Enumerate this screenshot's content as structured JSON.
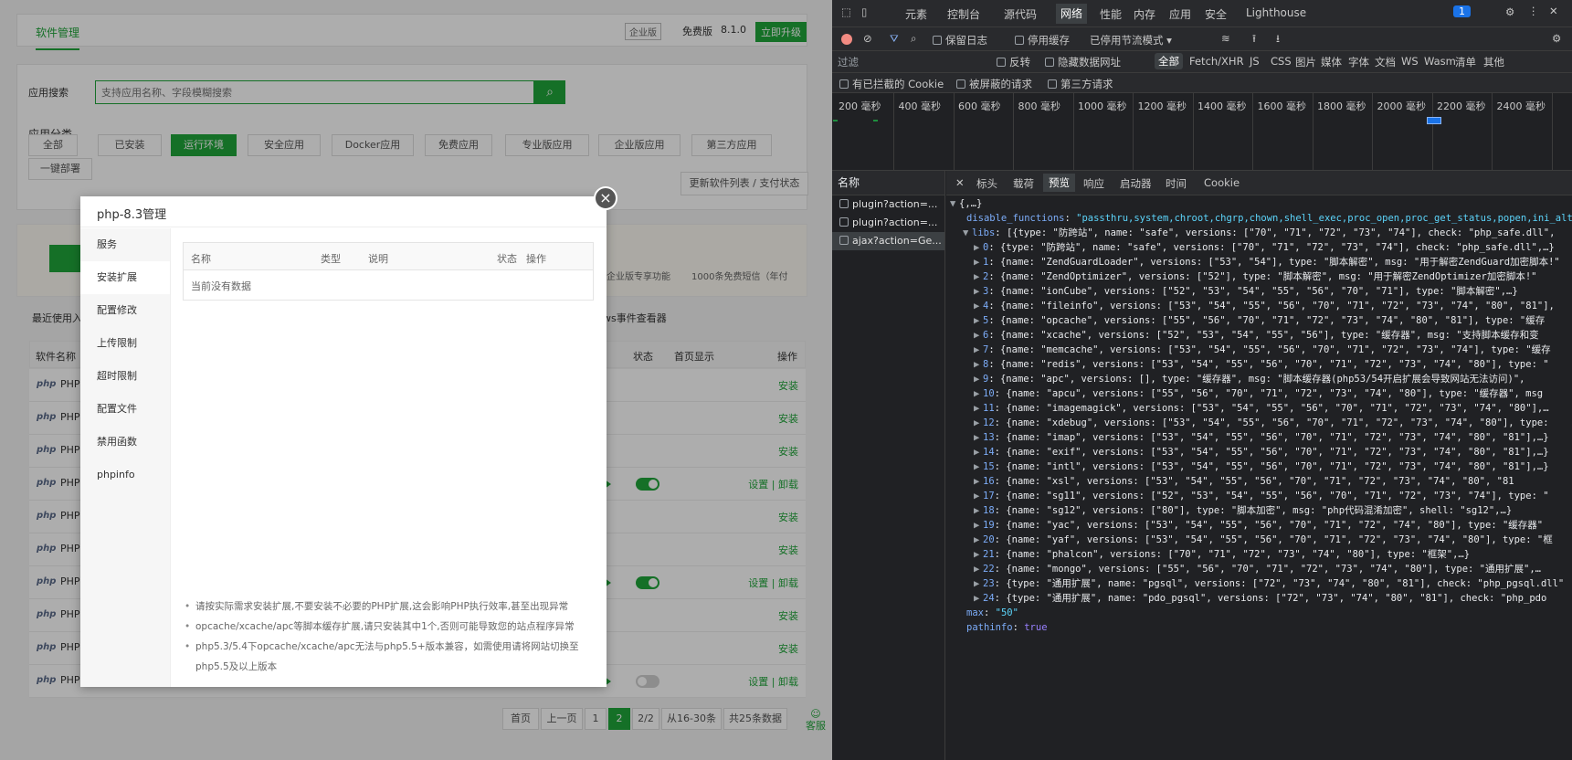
{
  "app": {
    "tab_title": "软件管理",
    "edition_badge": "企业版",
    "free_label": "免费版",
    "version": "8.1.0",
    "upgrade_label": "立即升级",
    "search_label": "应用搜索",
    "search_placeholder": "支持应用名称、字段模糊搜索",
    "category_label": "应用分类",
    "categories": [
      "全部",
      "已安装",
      "运行环境",
      "安全应用",
      "Docker应用",
      "免费应用",
      "专业版应用",
      "企业版应用",
      "第三方应用",
      "一键部署"
    ],
    "update_btn": "更新软件列表 / 支付状态",
    "promo_text": "企业版专享功能",
    "sms_text": "1000条免费短信（年付",
    "recent_label": "最近使用入",
    "event_viewer": "ws事件查看器",
    "col_name": "软件名称",
    "col_status": "状态",
    "col_home": "首页显示",
    "col_op": "操作",
    "rows": [
      {
        "name": "PHP",
        "action": "安装"
      },
      {
        "name": "PHP",
        "action": "安装"
      },
      {
        "name": "PHP",
        "action": "安装"
      },
      {
        "name": "PHP",
        "action": "设置 | 卸载"
      },
      {
        "name": "PHP",
        "action": "安装"
      },
      {
        "name": "PHP",
        "action": "安装"
      },
      {
        "name": "PHP",
        "action": "设置 | 卸载"
      },
      {
        "name": "PHP",
        "action": "安装"
      },
      {
        "name": "PHP",
        "action": "安装"
      },
      {
        "name": "PHP",
        "action": "设置 | 卸载"
      }
    ],
    "php_logo": "php",
    "pagination": [
      "首页",
      "上一页",
      "1",
      "2",
      "2/2",
      "从16-30条",
      "共25条数据"
    ],
    "service": "客服"
  },
  "modal": {
    "title": "php-8.3管理",
    "menu": [
      "服务",
      "安装扩展",
      "配置修改",
      "上传限制",
      "超时限制",
      "配置文件",
      "禁用函数",
      "phpinfo"
    ],
    "table_headers": [
      "名称",
      "类型",
      "说明",
      "状态",
      "操作"
    ],
    "empty": "当前没有数据",
    "notes": [
      "请按实际需求安装扩展,不要安装不必要的PHP扩展,这会影响PHP执行效率,甚至出现异常",
      "opcache/xcache/apc等脚本缓存扩展,请只安装其中1个,否则可能导致您的站点程序异常",
      "php5.3/5.4下opcache/xcache/apc无法与php5.5+版本兼容，如需使用请将网站切换至php5.5及以上版本"
    ],
    "close": "×"
  },
  "devtools": {
    "tabs": [
      "元素",
      "控制台",
      "源代码",
      "网络",
      "性能",
      "内存",
      "应用",
      "安全",
      "Lighthouse"
    ],
    "badge": "1",
    "preserve_log": "保留日志",
    "disable_cache": "停用缓存",
    "throttle": "已停用节流模式",
    "filter_placeholder": "过滤",
    "invert": "反转",
    "hide_data_url": "隐藏数据网址",
    "all": "全部",
    "types": [
      "Fetch/XHR",
      "JS",
      "CSS",
      "图片",
      "媒体",
      "字体",
      "文档",
      "WS",
      "Wasm",
      "清单",
      "其他"
    ],
    "blocked_cookie": "有已拦截的 Cookie",
    "blocked_req": "被屏蔽的请求",
    "third_party": "第三方请求",
    "timeline": [
      "200 毫秒",
      "400 毫秒",
      "600 毫秒",
      "800 毫秒",
      "1000 毫秒",
      "1200 毫秒",
      "1400 毫秒",
      "1600 毫秒",
      "1800 毫秒",
      "2000 毫秒",
      "2200 毫秒",
      "2400 毫秒"
    ],
    "name_header": "名称",
    "detail_tabs": [
      "标头",
      "载荷",
      "预览",
      "响应",
      "启动器",
      "时间",
      "Cookie"
    ],
    "requests": [
      "plugin?action=...",
      "plugin?action=...",
      "ajax?action=Ge..."
    ],
    "json_lines": [
      {
        "t": "root",
        "text": "{,…}"
      },
      {
        "t": "kv",
        "key": "disable_functions",
        "val": "\"passthru,system,chroot,chgrp,chown,shell_exec,proc_open,proc_get_status,popen,ini_alter\""
      },
      {
        "t": "kvp",
        "key": "libs",
        "val": "[{type: \"防跨站\", name: \"safe\", versions: [\"70\", \"71\", \"72\", \"73\", \"74\"], check: \"php_safe.dll\","
      },
      {
        "t": "item",
        "key": "0",
        "val": "{type: \"防跨站\", name: \"safe\", versions: [\"70\", \"71\", \"72\", \"73\", \"74\"], check: \"php_safe.dll\",…}"
      },
      {
        "t": "item",
        "key": "1",
        "val": "{name: \"ZendGuardLoader\", versions: [\"53\", \"54\"], type: \"脚本解密\", msg: \"用于解密ZendGuard加密脚本!\""
      },
      {
        "t": "item",
        "key": "2",
        "val": "{name: \"ZendOptimizer\", versions: [\"52\"], type: \"脚本解密\", msg: \"用于解密ZendOptimizer加密脚本!\""
      },
      {
        "t": "item",
        "key": "3",
        "val": "{name: \"ionCube\", versions: [\"52\", \"53\", \"54\", \"55\", \"56\", \"70\", \"71\"], type: \"脚本解密\",…}"
      },
      {
        "t": "item",
        "key": "4",
        "val": "{name: \"fileinfo\", versions: [\"53\", \"54\", \"55\", \"56\", \"70\", \"71\", \"72\", \"73\", \"74\", \"80\", \"81\"],"
      },
      {
        "t": "item",
        "key": "5",
        "val": "{name: \"opcache\", versions: [\"55\", \"56\", \"70\", \"71\", \"72\", \"73\", \"74\", \"80\", \"81\"], type: \"缓存"
      },
      {
        "t": "item",
        "key": "6",
        "val": "{name: \"xcache\", versions: [\"52\", \"53\", \"54\", \"55\", \"56\"], type: \"缓存器\", msg: \"支持脚本缓存和变"
      },
      {
        "t": "item",
        "key": "7",
        "val": "{name: \"memcache\", versions: [\"53\", \"54\", \"55\", \"56\", \"70\", \"71\", \"72\", \"73\", \"74\"], type: \"缓存"
      },
      {
        "t": "item",
        "key": "8",
        "val": "{name: \"redis\", versions: [\"53\", \"54\", \"55\", \"56\", \"70\", \"71\", \"72\", \"73\", \"74\", \"80\"], type: \""
      },
      {
        "t": "item",
        "key": "9",
        "val": "{name: \"apc\", versions: [], type: \"缓存器\", msg: \"脚本缓存器(php53/54开启扩展会导致网站无法访问)\","
      },
      {
        "t": "item",
        "key": "10",
        "val": "{name: \"apcu\", versions: [\"55\", \"56\", \"70\", \"71\", \"72\", \"73\", \"74\", \"80\"], type: \"缓存器\", msg"
      },
      {
        "t": "item",
        "key": "11",
        "val": "{name: \"imagemagick\", versions: [\"53\", \"54\", \"55\", \"56\", \"70\", \"71\", \"72\", \"73\", \"74\", \"80\"],…"
      },
      {
        "t": "item",
        "key": "12",
        "val": "{name: \"xdebug\", versions: [\"53\", \"54\", \"55\", \"56\", \"70\", \"71\", \"72\", \"73\", \"74\", \"80\"], type:"
      },
      {
        "t": "item",
        "key": "13",
        "val": "{name: \"imap\", versions: [\"53\", \"54\", \"55\", \"56\", \"70\", \"71\", \"72\", \"73\", \"74\", \"80\", \"81\"],…}"
      },
      {
        "t": "item",
        "key": "14",
        "val": "{name: \"exif\", versions: [\"53\", \"54\", \"55\", \"56\", \"70\", \"71\", \"72\", \"73\", \"74\", \"80\", \"81\"],…}"
      },
      {
        "t": "item",
        "key": "15",
        "val": "{name: \"intl\", versions: [\"53\", \"54\", \"55\", \"56\", \"70\", \"71\", \"72\", \"73\", \"74\", \"80\", \"81\"],…}"
      },
      {
        "t": "item",
        "key": "16",
        "val": "{name: \"xsl\", versions: [\"53\", \"54\", \"55\", \"56\", \"70\", \"71\", \"72\", \"73\", \"74\", \"80\", \"81"
      },
      {
        "t": "item",
        "key": "17",
        "val": "{name: \"sg11\", versions: [\"52\", \"53\", \"54\", \"55\", \"56\", \"70\", \"71\", \"72\", \"73\", \"74\"], type: \""
      },
      {
        "t": "item",
        "key": "18",
        "val": "{name: \"sg12\", versions: [\"80\"], type: \"脚本加密\", msg: \"php代码混淆加密\", shell: \"sg12\",…}"
      },
      {
        "t": "item",
        "key": "19",
        "val": "{name: \"yac\", versions: [\"53\", \"54\", \"55\", \"56\", \"70\", \"71\", \"72\", \"74\", \"80\"], type: \"缓存器\""
      },
      {
        "t": "item",
        "key": "20",
        "val": "{name: \"yaf\", versions: [\"53\", \"54\", \"55\", \"56\", \"70\", \"71\", \"72\", \"73\", \"74\", \"80\"], type: \"框"
      },
      {
        "t": "item",
        "key": "21",
        "val": "{name: \"phalcon\", versions: [\"70\", \"71\", \"72\", \"73\", \"74\", \"80\"], type: \"框架\",…}"
      },
      {
        "t": "item",
        "key": "22",
        "val": "{name: \"mongo\", versions: [\"55\", \"56\", \"70\", \"71\", \"72\", \"73\", \"74\", \"80\"], type: \"通用扩展\",…"
      },
      {
        "t": "item",
        "key": "23",
        "val": "{type: \"通用扩展\", name: \"pgsql\", versions: [\"72\", \"73\", \"74\", \"80\", \"81\"], check: \"php_pgsql.dll\""
      },
      {
        "t": "item",
        "key": "24",
        "val": "{type: \"通用扩展\", name: \"pdo_pgsql\", versions: [\"72\", \"73\", \"74\", \"80\", \"81\"], check: \"php_pdo"
      },
      {
        "t": "kvs",
        "key": "max",
        "val": "\"50\""
      },
      {
        "t": "kvb",
        "key": "pathinfo",
        "val": "true"
      }
    ]
  }
}
